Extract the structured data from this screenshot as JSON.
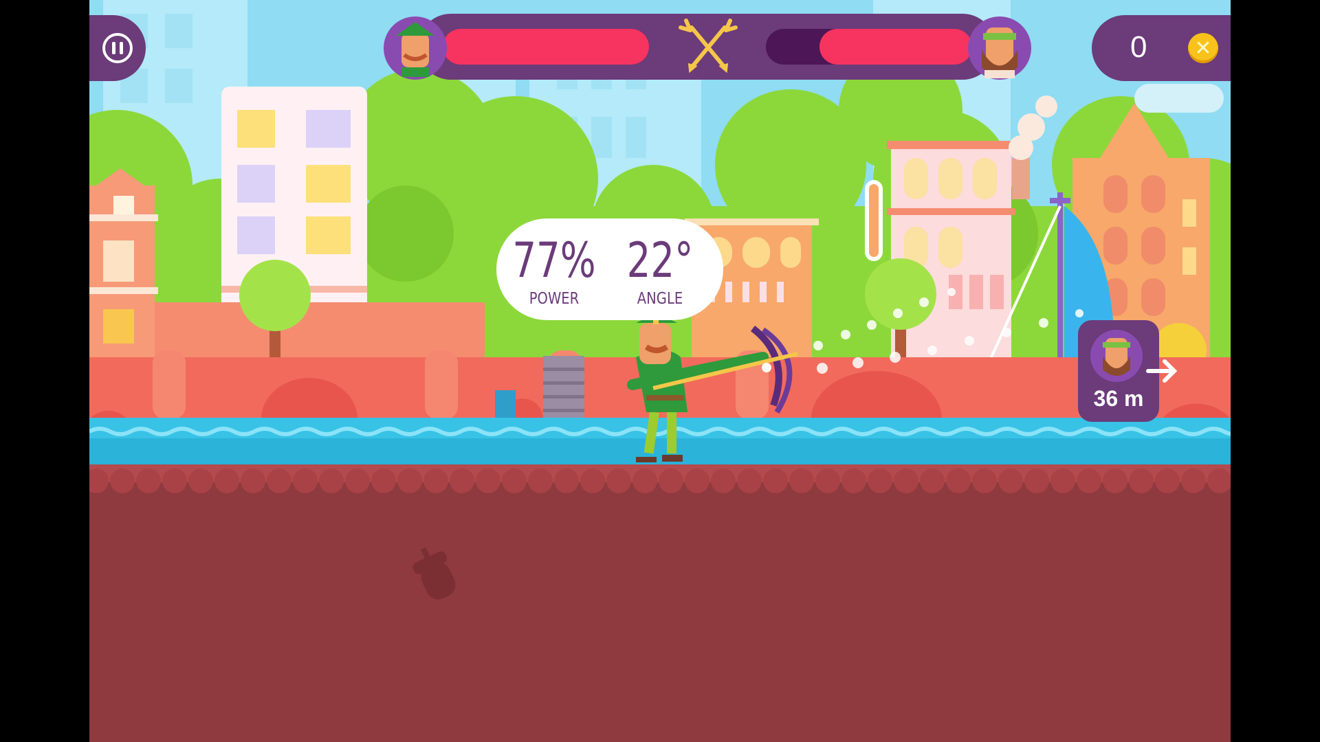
{
  "hud": {
    "pause_icon": "pause-icon",
    "coins": "0",
    "coin_icon": "coin-icon",
    "player_health": 1.0,
    "enemy_health": 0.74,
    "versus_icon": "crossed-arrows-icon"
  },
  "aim": {
    "power": "77%",
    "power_label": "POWER",
    "angle": "22°",
    "angle_label": "ANGLE"
  },
  "enemy_indicator": {
    "distance": "36 m",
    "arrow_icon": "arrow-right-icon"
  },
  "colors": {
    "hud_purple": "#6b3b7a",
    "health_red": "#f7335f",
    "health_dark": "#4d1657",
    "sky": "#8fdcf3",
    "grass": "#8cd83a",
    "wall": "#f26a5c",
    "water": "#38c2e6",
    "ground": "#8e3a3e"
  }
}
